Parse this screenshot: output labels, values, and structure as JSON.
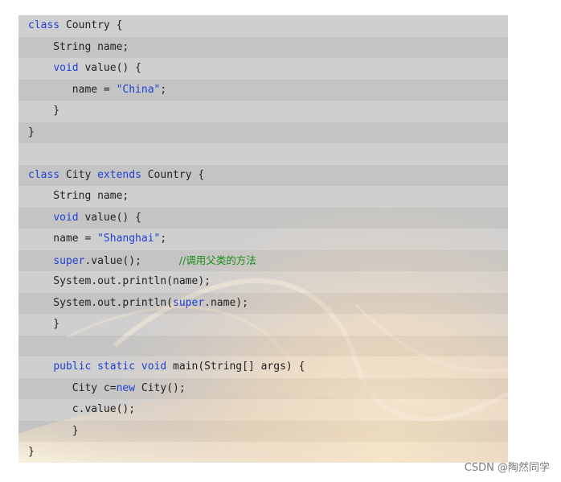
{
  "code": {
    "lines": [
      [
        {
          "t": "class",
          "k": "kw"
        },
        {
          "t": " Country {",
          "k": "plain"
        }
      ],
      [
        {
          "t": "    String name;",
          "k": "plain"
        }
      ],
      [
        {
          "t": "    ",
          "k": "plain"
        },
        {
          "t": "void",
          "k": "kw"
        },
        {
          "t": " value() {",
          "k": "plain"
        }
      ],
      [
        {
          "t": "       name = ",
          "k": "plain"
        },
        {
          "t": "\"China\"",
          "k": "str"
        },
        {
          "t": ";",
          "k": "plain"
        }
      ],
      [
        {
          "t": "    }",
          "k": "plain"
        }
      ],
      [
        {
          "t": "}",
          "k": "plain"
        }
      ],
      [],
      [
        {
          "t": "class",
          "k": "kw"
        },
        {
          "t": " City ",
          "k": "plain"
        },
        {
          "t": "extends",
          "k": "kw"
        },
        {
          "t": " Country {",
          "k": "plain"
        }
      ],
      [
        {
          "t": "    String name;",
          "k": "plain"
        }
      ],
      [
        {
          "t": "    ",
          "k": "plain"
        },
        {
          "t": "void",
          "k": "kw"
        },
        {
          "t": " value() {",
          "k": "plain"
        }
      ],
      [
        {
          "t": "    name = ",
          "k": "plain"
        },
        {
          "t": "\"Shanghai\"",
          "k": "str"
        },
        {
          "t": ";",
          "k": "plain"
        }
      ],
      [
        {
          "t": "    ",
          "k": "plain"
        },
        {
          "t": "super",
          "k": "kw"
        },
        {
          "t": ".value();      ",
          "k": "plain"
        },
        {
          "t": "//调用父类的方法",
          "k": "cmt"
        }
      ],
      [
        {
          "t": "    System.out.println(name);",
          "k": "plain"
        }
      ],
      [
        {
          "t": "    System.out.println(",
          "k": "plain"
        },
        {
          "t": "super",
          "k": "kw"
        },
        {
          "t": ".name);",
          "k": "plain"
        }
      ],
      [
        {
          "t": "    }",
          "k": "plain"
        }
      ],
      [],
      [
        {
          "t": "    ",
          "k": "plain"
        },
        {
          "t": "public static void",
          "k": "kw"
        },
        {
          "t": " main(String[] args) {",
          "k": "plain"
        }
      ],
      [
        {
          "t": "       City c=",
          "k": "plain"
        },
        {
          "t": "new",
          "k": "kw"
        },
        {
          "t": " City();",
          "k": "plain"
        }
      ],
      [
        {
          "t": "       c.value();",
          "k": "plain"
        }
      ],
      [
        {
          "t": "       }",
          "k": "plain"
        }
      ],
      [
        {
          "t": "}",
          "k": "plain"
        }
      ]
    ]
  },
  "watermark": "CSDN @陶然同学",
  "colors": {
    "keyword": "#1f3fd6",
    "string": "#1f3fd6",
    "comment": "#1a8a1a",
    "text": "#222222",
    "background": "#cccccc"
  }
}
